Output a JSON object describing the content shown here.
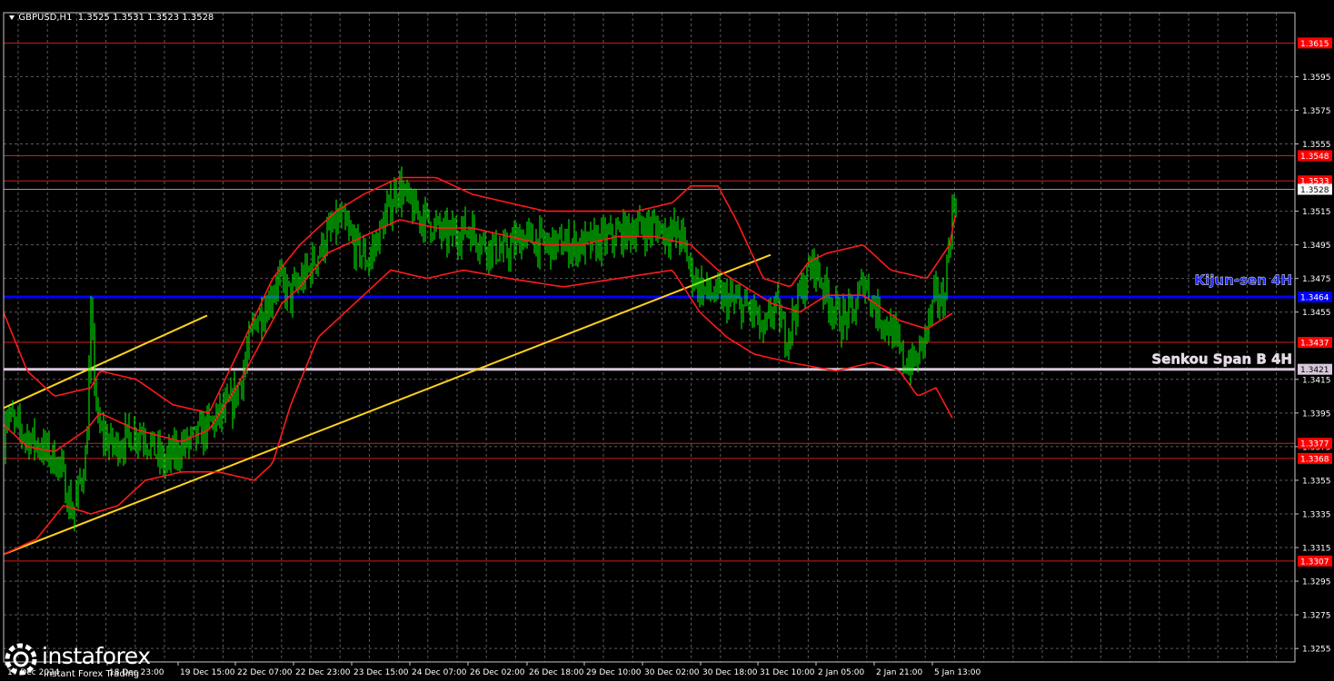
{
  "header": {
    "symbol_label": "GBPUSD,H1",
    "ohlc": "1.3525 1.3531 1.3523 1.3528"
  },
  "branding": {
    "name": "instaforex",
    "tagline": "Instant Forex Trading"
  },
  "icons": [
    "dropdown-triangle-icon",
    "instaforex-logo-icon"
  ],
  "colors": {
    "background": "#000000",
    "grid": "#5a5a5a",
    "candles": "#00ff00",
    "envelope": "#ff1a1a",
    "level_lines": "#d41a1a",
    "kijun": "#0000ff",
    "senkou": "#d8c8dc",
    "trendline": "#ffd21a",
    "axis_text": "#ffffff",
    "level_label_bg": "#ff0000",
    "kijun_label_text": "#1a24ff",
    "senkou_label_text": "#e4d6e6"
  },
  "chart_data": {
    "type": "line",
    "title": "GBPUSD,H1",
    "ylim": [
      1.3247,
      1.3633
    ],
    "grid": true,
    "y_ticks": [
      "1.3595",
      "1.3575",
      "1.3555",
      "1.3515",
      "1.3495",
      "1.3475",
      "1.3455",
      "1.3415",
      "1.3395",
      "1.3375",
      "1.3355",
      "1.3335",
      "1.3315",
      "1.3295",
      "1.3275",
      "1.3255"
    ],
    "x_ticks": [
      "17 Dec 2024",
      "18 Dec 23:00",
      "19 Dec 15:00",
      "22 Dec 07:00",
      "22 Dec 23:00",
      "23 Dec 15:00",
      "24 Dec 07:00",
      "26 Dec 02:00",
      "26 Dec 18:00",
      "29 Dec 10:00",
      "30 Dec 02:00",
      "30 Dec 18:00",
      "31 Dec 10:00",
      "2 Jan 05:00",
      "2 Jan 21:00",
      "5 Jan 13:00"
    ],
    "levels": [
      {
        "price": 1.3615,
        "label": "1.3615",
        "style": "red"
      },
      {
        "price": 1.3548,
        "label": "1.3548",
        "style": "red"
      },
      {
        "price": 1.3533,
        "label": "1.3533",
        "style": "red"
      },
      {
        "price": 1.3437,
        "label": "1.3437",
        "style": "red"
      },
      {
        "price": 1.3377,
        "label": "1.3377",
        "style": "red"
      },
      {
        "price": 1.3368,
        "label": "1.3368",
        "style": "red"
      },
      {
        "price": 1.3307,
        "label": "1.3307",
        "style": "red"
      },
      {
        "price": 1.3464,
        "label": "1.3464",
        "style": "kijun"
      },
      {
        "price": 1.3421,
        "label": "1.3421",
        "style": "senkou"
      }
    ],
    "current_price": {
      "price": 1.3528,
      "label": "1.3528"
    },
    "annotations": [
      {
        "text": "Kijun-sen 4H",
        "price": 1.3474,
        "color": "kijun"
      },
      {
        "text": "Senkou Span B 4H",
        "price": 1.3427,
        "color": "senkou"
      }
    ],
    "trendlines": [
      {
        "from": {
          "x": "17 Dec 2024",
          "price": 1.3398
        },
        "to": {
          "x": "18 Dec 23:00",
          "price": 1.3453
        }
      },
      {
        "from": {
          "x": "17 Dec 2024",
          "price": 1.3311
        },
        "to": {
          "x": "30 Dec 18:00",
          "price": 1.3489
        }
      }
    ],
    "price_anchors": [
      [
        0,
        1.3345
      ],
      [
        6,
        1.3395
      ],
      [
        20,
        1.3385
      ],
      [
        45,
        1.3375
      ],
      [
        65,
        1.3365
      ],
      [
        80,
        1.3335
      ],
      [
        95,
        1.337
      ],
      [
        100,
        1.345
      ],
      [
        108,
        1.3385
      ],
      [
        125,
        1.3375
      ],
      [
        155,
        1.3385
      ],
      [
        180,
        1.3365
      ],
      [
        200,
        1.3375
      ],
      [
        215,
        1.338
      ],
      [
        235,
        1.339
      ],
      [
        255,
        1.34
      ],
      [
        268,
        1.342
      ],
      [
        280,
        1.345
      ],
      [
        295,
        1.346
      ],
      [
        305,
        1.3475
      ],
      [
        320,
        1.3465
      ],
      [
        340,
        1.348
      ],
      [
        360,
        1.35
      ],
      [
        375,
        1.351
      ],
      [
        390,
        1.3495
      ],
      [
        405,
        1.3485
      ],
      [
        420,
        1.3505
      ],
      [
        438,
        1.353
      ],
      [
        455,
        1.3515
      ],
      [
        470,
        1.351
      ],
      [
        490,
        1.35
      ],
      [
        515,
        1.3505
      ],
      [
        535,
        1.3495
      ],
      [
        555,
        1.349
      ],
      [
        575,
        1.35
      ],
      [
        600,
        1.3495
      ],
      [
        625,
        1.3495
      ],
      [
        650,
        1.3495
      ],
      [
        675,
        1.35
      ],
      [
        700,
        1.3505
      ],
      [
        725,
        1.3505
      ],
      [
        750,
        1.35
      ],
      [
        760,
        1.348
      ],
      [
        770,
        1.347
      ],
      [
        785,
        1.3465
      ],
      [
        810,
        1.346
      ],
      [
        830,
        1.3455
      ],
      [
        840,
        1.344
      ],
      [
        852,
        1.346
      ],
      [
        865,
        1.344
      ],
      [
        880,
        1.3465
      ],
      [
        895,
        1.3485
      ],
      [
        910,
        1.3465
      ],
      [
        925,
        1.345
      ],
      [
        940,
        1.3455
      ],
      [
        950,
        1.3475
      ],
      [
        965,
        1.3455
      ],
      [
        980,
        1.3445
      ],
      [
        995,
        1.3425
      ],
      [
        1008,
        1.3425
      ],
      [
        1020,
        1.3445
      ],
      [
        1030,
        1.3465
      ],
      [
        1038,
        1.346
      ],
      [
        1045,
        1.35
      ],
      [
        1052,
        1.3528
      ]
    ],
    "envelope_mid_anchors": [
      [
        0,
        1.339
      ],
      [
        30,
        1.3375
      ],
      [
        60,
        1.3372
      ],
      [
        95,
        1.3385
      ],
      [
        110,
        1.3395
      ],
      [
        150,
        1.3385
      ],
      [
        200,
        1.3378
      ],
      [
        230,
        1.3385
      ],
      [
        260,
        1.341
      ],
      [
        290,
        1.344
      ],
      [
        310,
        1.346
      ],
      [
        330,
        1.347
      ],
      [
        360,
        1.349
      ],
      [
        400,
        1.35
      ],
      [
        440,
        1.351
      ],
      [
        480,
        1.3505
      ],
      [
        520,
        1.3505
      ],
      [
        560,
        1.35
      ],
      [
        600,
        1.3495
      ],
      [
        640,
        1.3495
      ],
      [
        680,
        1.35
      ],
      [
        720,
        1.35
      ],
      [
        760,
        1.3495
      ],
      [
        790,
        1.348
      ],
      [
        820,
        1.347
      ],
      [
        850,
        1.346
      ],
      [
        880,
        1.3455
      ],
      [
        910,
        1.3465
      ],
      [
        950,
        1.3465
      ],
      [
        990,
        1.345
      ],
      [
        1020,
        1.3445
      ],
      [
        1050,
        1.3455
      ]
    ],
    "envelope_upper_anchors": [
      [
        0,
        1.346
      ],
      [
        30,
        1.342
      ],
      [
        60,
        1.3405
      ],
      [
        100,
        1.341
      ],
      [
        110,
        1.342
      ],
      [
        150,
        1.3415
      ],
      [
        190,
        1.34
      ],
      [
        230,
        1.3395
      ],
      [
        270,
        1.344
      ],
      [
        300,
        1.3475
      ],
      [
        330,
        1.3495
      ],
      [
        370,
        1.3515
      ],
      [
        400,
        1.3525
      ],
      [
        440,
        1.3535
      ],
      [
        480,
        1.3535
      ],
      [
        520,
        1.3525
      ],
      [
        560,
        1.352
      ],
      [
        600,
        1.3515
      ],
      [
        650,
        1.3515
      ],
      [
        700,
        1.3515
      ],
      [
        740,
        1.352
      ],
      [
        760,
        1.353
      ],
      [
        790,
        1.353
      ],
      [
        810,
        1.351
      ],
      [
        840,
        1.3475
      ],
      [
        870,
        1.347
      ],
      [
        890,
        1.3485
      ],
      [
        910,
        1.349
      ],
      [
        950,
        1.3495
      ],
      [
        980,
        1.348
      ],
      [
        1020,
        1.3475
      ],
      [
        1045,
        1.3495
      ],
      [
        1052,
        1.3515
      ]
    ],
    "envelope_lower_anchors": [
      [
        0,
        1.331
      ],
      [
        40,
        1.332
      ],
      [
        70,
        1.334
      ],
      [
        100,
        1.3335
      ],
      [
        130,
        1.334
      ],
      [
        160,
        1.3355
      ],
      [
        200,
        1.336
      ],
      [
        240,
        1.336
      ],
      [
        280,
        1.3355
      ],
      [
        300,
        1.3365
      ],
      [
        320,
        1.34
      ],
      [
        350,
        1.344
      ],
      [
        390,
        1.346
      ],
      [
        430,
        1.348
      ],
      [
        470,
        1.3475
      ],
      [
        510,
        1.348
      ],
      [
        560,
        1.3475
      ],
      [
        620,
        1.347
      ],
      [
        680,
        1.3475
      ],
      [
        740,
        1.348
      ],
      [
        770,
        1.3455
      ],
      [
        800,
        1.344
      ],
      [
        830,
        1.343
      ],
      [
        870,
        1.3425
      ],
      [
        920,
        1.342
      ],
      [
        960,
        1.3425
      ],
      [
        990,
        1.342
      ],
      [
        1010,
        1.3405
      ],
      [
        1030,
        1.341
      ],
      [
        1045,
        1.3395
      ],
      [
        1050,
        1.339
      ]
    ]
  }
}
